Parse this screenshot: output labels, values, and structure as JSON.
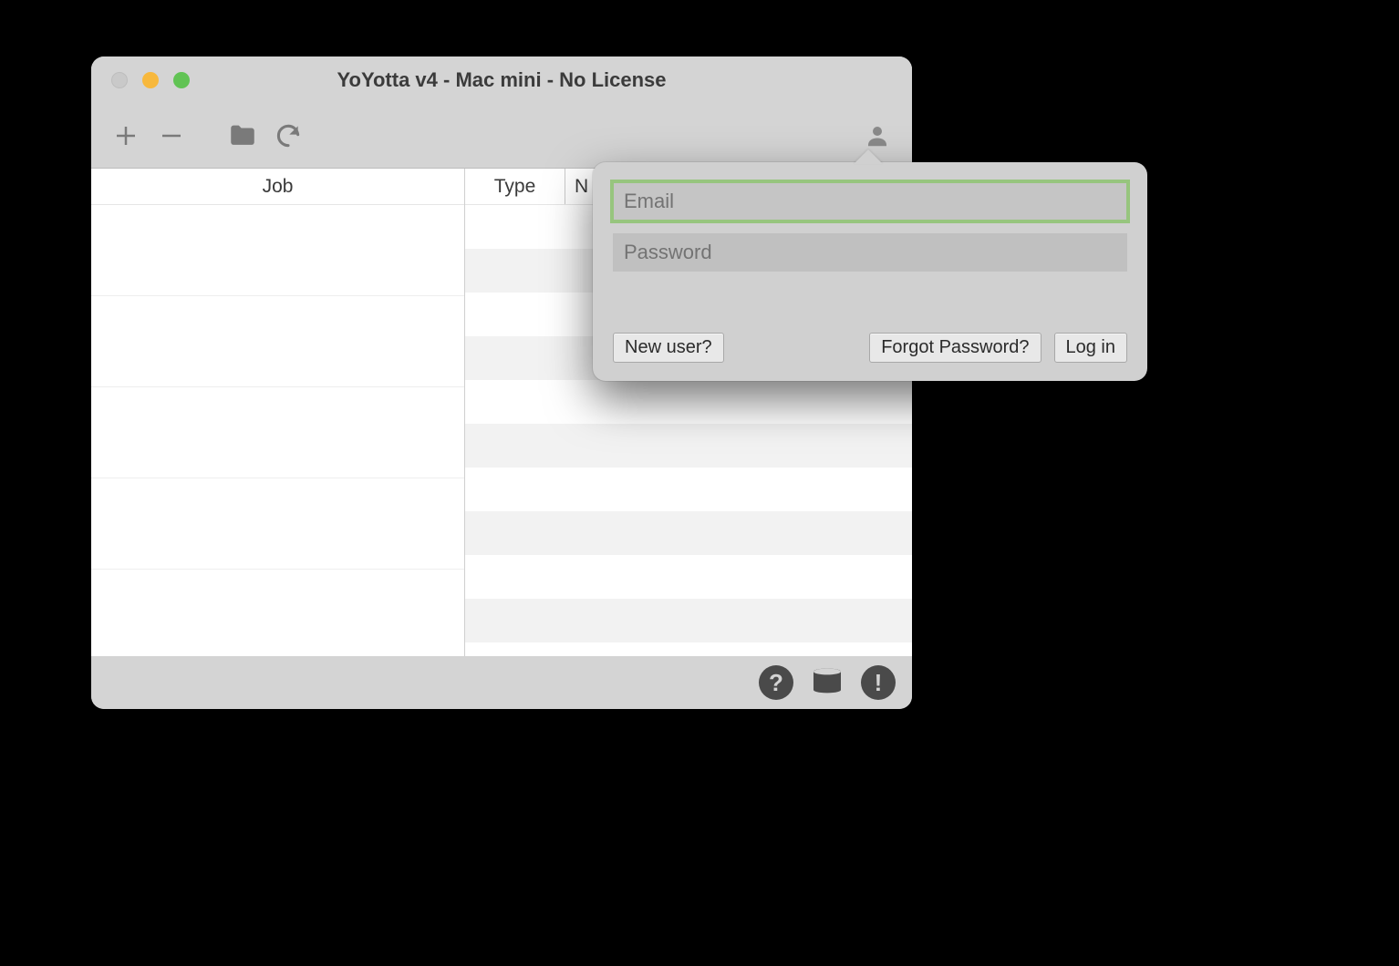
{
  "window": {
    "title": "YoYotta v4 - Mac mini - No License"
  },
  "toolbar": {
    "icons": {
      "add": "plus-icon",
      "remove": "minus-icon",
      "folder": "folder-icon",
      "refresh": "refresh-icon",
      "user": "user-icon"
    }
  },
  "columns": {
    "job": "Job",
    "type": "Type",
    "n": "N"
  },
  "login": {
    "email_placeholder": "Email",
    "password_placeholder": "Password",
    "new_user_label": "New user?",
    "forgot_label": "Forgot Password?",
    "login_label": "Log in"
  },
  "footer": {
    "icons": {
      "help": "help-icon",
      "log": "log-icon",
      "alert": "alert-icon"
    }
  }
}
